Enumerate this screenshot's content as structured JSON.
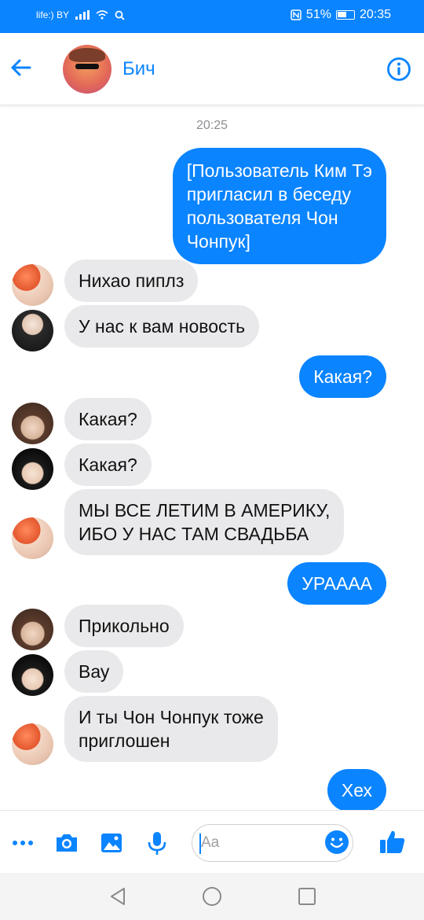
{
  "status_bar": {
    "carrier": "life:) BY",
    "battery": "51%",
    "time": "20:35"
  },
  "header": {
    "title": "Бич"
  },
  "chat": {
    "timestamp": "20:25",
    "messages": [
      {
        "dir": "out",
        "text": "[Пользователь Ким Тэ\nпригласил в беседу\nпользователя Чон\nЧонпук]"
      },
      {
        "dir": "in",
        "text": "Нихао пиплз"
      },
      {
        "dir": "in",
        "text": "У нас к вам новость"
      },
      {
        "dir": "out",
        "text": "Какая?"
      },
      {
        "dir": "in",
        "text": "Какая?"
      },
      {
        "dir": "in",
        "text": "Какая?"
      },
      {
        "dir": "in",
        "text": "МЫ ВСЕ ЛЕТИМ В АМЕРИКУ,\nИБО У НАС ТАМ СВАДЬБА"
      },
      {
        "dir": "out",
        "text": "УРАААА"
      },
      {
        "dir": "in",
        "text": "Прикольно"
      },
      {
        "dir": "in",
        "text": "Вау"
      },
      {
        "dir": "in",
        "text": "И ты Чон Чонпук тоже\nприглошен"
      },
      {
        "dir": "out",
        "text": "Хех"
      }
    ]
  },
  "composer": {
    "placeholder": "Aa"
  },
  "colors": {
    "accent": "#0a84ff",
    "incoming_bubble": "#e9e9eb"
  }
}
